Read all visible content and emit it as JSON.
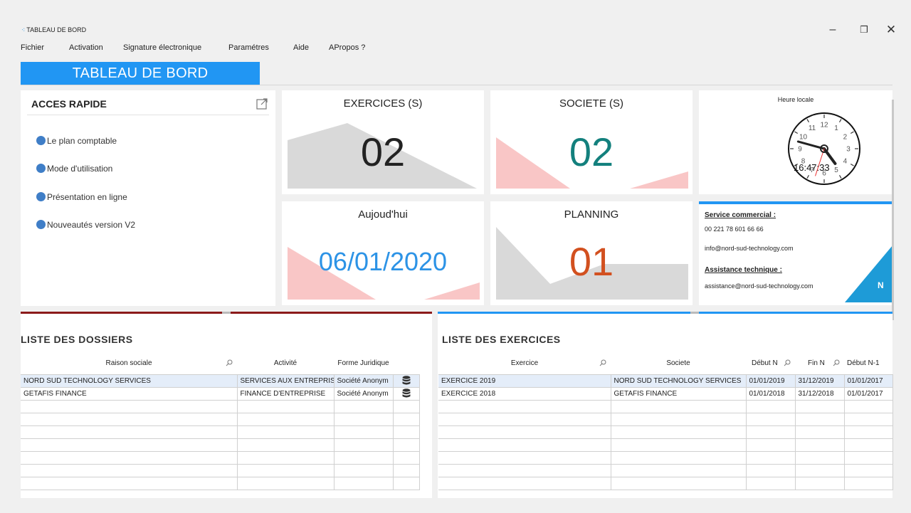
{
  "window": {
    "title": "TABLEAU DE BORD",
    "minimize_symbol": "–",
    "maximize_symbol": "❐",
    "close_symbol": "✕"
  },
  "menu": {
    "items": [
      "Fichier",
      "Activation",
      "Signature électronique",
      "Paramétres",
      "Aide",
      "APropos ?"
    ]
  },
  "page_tab": {
    "label": "TABLEAU DE BORD"
  },
  "quick_access": {
    "title": "ACCES RAPIDE",
    "items": [
      "Le plan comptable",
      "Mode d'utilisation",
      "Présentation en ligne",
      "Nouveautés version V2"
    ]
  },
  "tiles": {
    "exercices": {
      "label": "EXERCICES (S)",
      "value": "02",
      "color": "#222222"
    },
    "societes": {
      "label": "SOCIETE (S)",
      "value": "02",
      "color": "#13807d"
    },
    "today": {
      "label": "Aujoud'hui",
      "value": "06/01/2020",
      "color": "#2c93e6"
    },
    "planning": {
      "label": "PLANNING",
      "value": "01",
      "color": "#d2501f"
    }
  },
  "clock": {
    "label": "Heure locale",
    "time": "16:47:33",
    "numbers": [
      "12",
      "1",
      "2",
      "3",
      "4",
      "5",
      "6",
      "7",
      "8",
      "9",
      "10",
      "11"
    ]
  },
  "contact": {
    "commercial_title": "Service commercial :",
    "phone": "00 221 78 601 66 66",
    "email_info": "info@nord-sud-technology.com",
    "support_title": "Assistance technique :",
    "email_support": "assistance@nord-sud-technology.com",
    "badge_text": "N"
  },
  "dossiers": {
    "title": "LISTE DES DOSSIERS",
    "columns": [
      "Raison sociale",
      "Activité",
      "Forme Juridique",
      ""
    ],
    "rows": [
      [
        "NORD SUD TECHNOLOGY SERVICES",
        "SERVICES AUX ENTREPRIS",
        "Société Anonym"
      ],
      [
        "GETAFIS FINANCE",
        "FINANCE D'ENTREPRISE",
        "Société Anonym"
      ]
    ]
  },
  "exercices": {
    "title": "LISTE DES EXERCICES",
    "columns": [
      "Exercice",
      "Societe",
      "Début N",
      "Fin N",
      "Début N-1"
    ],
    "rows": [
      [
        "EXERCICE 2019",
        "NORD SUD TECHNOLOGY SERVICES",
        "01/01/2019",
        "31/12/2019",
        "01/01/2017"
      ],
      [
        "EXERCICE 2018",
        "GETAFIS FINANCE",
        "01/01/2018",
        "31/12/2018",
        "01/01/2017"
      ]
    ]
  },
  "colors": {
    "accent_blue": "#2196f3",
    "dossiers_accent": "#8b1a1a",
    "bullet": "#3f7ec7",
    "selected_row": "#e4edf9"
  }
}
